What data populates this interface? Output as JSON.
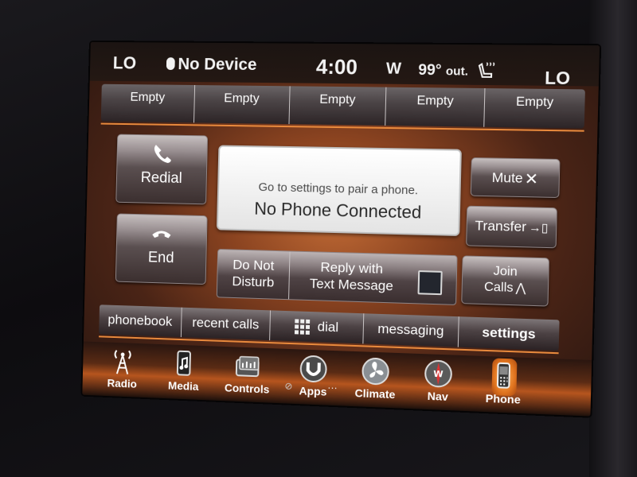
{
  "status": {
    "temp_left": "LO",
    "device": "No Device",
    "time": "4:00",
    "compass": "W",
    "outside_temp": "99°",
    "outside_label": "out.",
    "temp_right": "LO"
  },
  "presets": [
    "Empty",
    "Empty",
    "Empty",
    "Empty",
    "Empty"
  ],
  "left_buttons": {
    "redial": "Redial",
    "end": "End"
  },
  "message": {
    "hint": "Go to settings to pair a phone.",
    "title": "No Phone Connected"
  },
  "right_buttons": {
    "mute": "Mute",
    "transfer": "Transfer",
    "join_line1": "Join",
    "join_line2": "Calls"
  },
  "mid_bar": {
    "dnd_line1": "Do Not",
    "dnd_line2": "Disturb",
    "reply_line1": "Reply with",
    "reply_line2": "Text Message",
    "reply_checked": false
  },
  "tabs": [
    "phonebook",
    "recent calls",
    "dial",
    "messaging",
    "settings"
  ],
  "dock": [
    "Radio",
    "Media",
    "Controls",
    "Apps",
    "Climate",
    "Nav",
    "Phone"
  ],
  "icons": {
    "bluetooth": "bluetooth-icon",
    "seat": "heated-seat-icon",
    "redial": "phone-handset-icon",
    "end": "hang-up-icon",
    "mute": "mute-icon",
    "transfer": "transfer-to-phone-icon",
    "join": "conference-icon",
    "dial": "keypad-icon"
  },
  "colors": {
    "accent": "#e98a3d",
    "active_tab": "#e0741f"
  }
}
